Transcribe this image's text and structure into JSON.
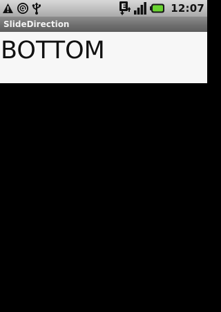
{
  "status_bar": {
    "time": "12:07",
    "left_icons": [
      "warning-icon",
      "at-sign-icon",
      "usb-icon"
    ],
    "right_icons": [
      "edge-network-icon",
      "signal-icon",
      "battery-icon"
    ],
    "edge_letter": "E",
    "battery_color": "#6ad431"
  },
  "title_bar": {
    "title": "SlideDirection"
  },
  "content": {
    "label": "BOTTOM"
  },
  "colors": {
    "background": "#000000",
    "content_background": "#f7f7f7",
    "title_bar": "#6e6e6e"
  }
}
